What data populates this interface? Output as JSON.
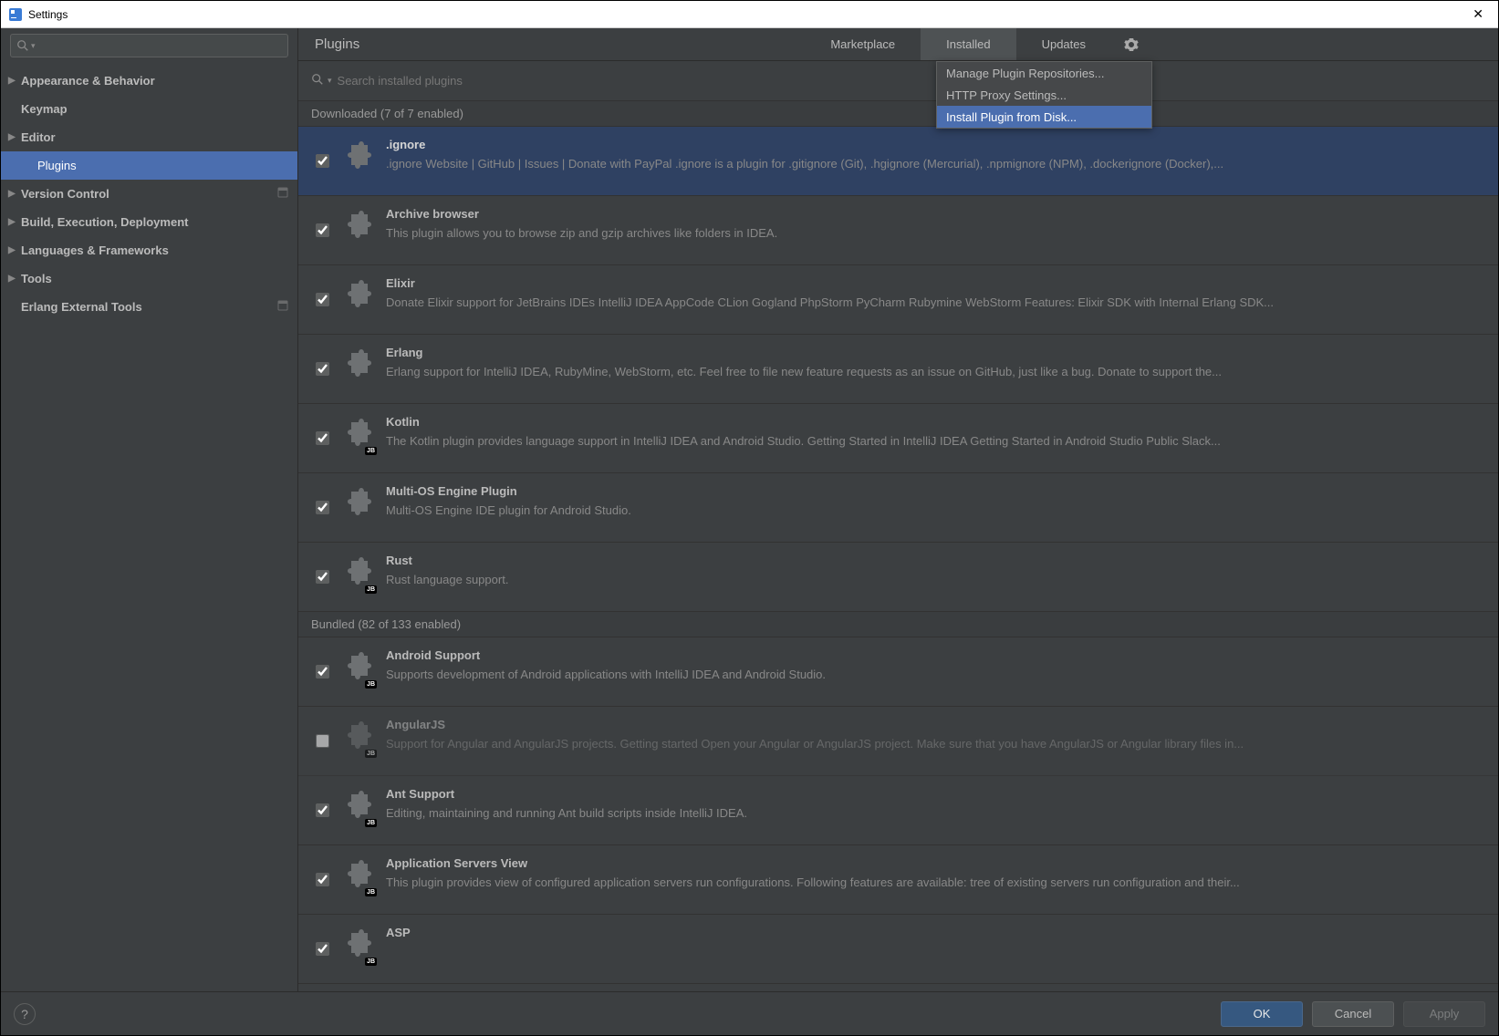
{
  "window": {
    "title": "Settings"
  },
  "sidebar": {
    "search_placeholder": "",
    "items": [
      {
        "label": "Appearance & Behavior",
        "bold": true,
        "arrow": true
      },
      {
        "label": "Keymap",
        "bold": true,
        "arrow": false
      },
      {
        "label": "Editor",
        "bold": true,
        "arrow": true
      },
      {
        "label": "Plugins",
        "bold": false,
        "arrow": false,
        "child": true,
        "selected": true
      },
      {
        "label": "Version Control",
        "bold": true,
        "arrow": true,
        "badge": true
      },
      {
        "label": "Build, Execution, Deployment",
        "bold": true,
        "arrow": true
      },
      {
        "label": "Languages & Frameworks",
        "bold": true,
        "arrow": true
      },
      {
        "label": "Tools",
        "bold": true,
        "arrow": true
      },
      {
        "label": "Erlang External Tools",
        "bold": true,
        "arrow": false,
        "badge": true
      }
    ]
  },
  "main": {
    "title": "Plugins",
    "tabs": [
      {
        "label": "Marketplace",
        "active": false
      },
      {
        "label": "Installed",
        "active": true
      },
      {
        "label": "Updates",
        "active": false
      }
    ],
    "gear_menu": [
      {
        "label": "Manage Plugin Repositories..."
      },
      {
        "label": "HTTP Proxy Settings..."
      },
      {
        "label": "Install Plugin from Disk...",
        "hover": true
      }
    ],
    "search_placeholder": "Search installed plugins",
    "sections": [
      {
        "header": "Downloaded (7 of 7 enabled)",
        "plugins": [
          {
            "name": ".ignore",
            "desc": ".ignore Website | GitHub | Issues | Donate with PayPal .ignore is a plugin for .gitignore (Git), .hgignore (Mercurial), .npmignore (NPM), .dockerignore (Docker),...",
            "checked": true,
            "selected": true,
            "jb": false
          },
          {
            "name": "Archive browser",
            "desc": "This plugin allows you to browse zip and gzip archives like folders in IDEA.",
            "checked": true,
            "jb": false
          },
          {
            "name": "Elixir",
            "desc": "Donate Elixir support for JetBrains IDEs IntelliJ IDEA AppCode CLion Gogland PhpStorm PyCharm Rubymine WebStorm Features: Elixir SDK with Internal Erlang SDK...",
            "checked": true,
            "jb": false
          },
          {
            "name": "Erlang",
            "desc": "Erlang support for IntelliJ IDEA, RubyMine, WebStorm, etc. Feel free to file new feature requests as an issue on GitHub, just like a bug. Donate to support the...",
            "checked": true,
            "jb": false
          },
          {
            "name": "Kotlin",
            "desc": "The Kotlin plugin provides language support in IntelliJ IDEA and Android Studio. Getting Started in IntelliJ IDEA Getting Started in Android Studio Public Slack...",
            "checked": true,
            "jb": true
          },
          {
            "name": "Multi-OS Engine Plugin",
            "desc": "Multi-OS Engine IDE plugin for Android Studio.",
            "checked": true,
            "jb": false
          },
          {
            "name": "Rust",
            "desc": "Rust language support.",
            "checked": true,
            "jb": true
          }
        ]
      },
      {
        "header": "Bundled (82 of 133 enabled)",
        "plugins": [
          {
            "name": "Android Support",
            "desc": "Supports development of Android applications with IntelliJ IDEA and Android Studio.",
            "checked": true,
            "jb": true
          },
          {
            "name": "AngularJS",
            "desc": "Support for Angular and AngularJS projects. Getting started Open your Angular or AngularJS project. Make sure that you have AngularJS or Angular library files in...",
            "checked": false,
            "jb": true,
            "disabled": true
          },
          {
            "name": "Ant Support",
            "desc": "Editing, maintaining and running Ant build scripts inside IntelliJ IDEA.",
            "checked": true,
            "jb": true
          },
          {
            "name": "Application Servers View",
            "desc": "This plugin provides view of configured application servers run configurations. Following features are available: tree of existing servers run configuration and their...",
            "checked": true,
            "jb": true
          },
          {
            "name": "ASP",
            "desc": "",
            "checked": true,
            "jb": true
          }
        ]
      }
    ]
  },
  "footer": {
    "ok": "OK",
    "cancel": "Cancel",
    "apply": "Apply"
  }
}
